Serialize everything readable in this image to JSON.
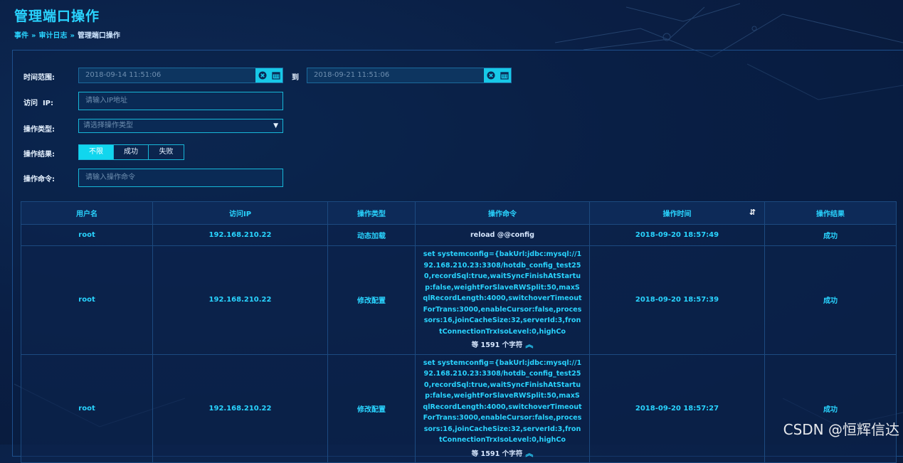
{
  "page": {
    "title": "管理端口操作",
    "breadcrumb": [
      "事件",
      "审计日志",
      "管理端口操作"
    ],
    "breadcrumb_sep": "»"
  },
  "filters": {
    "time_range_label": "时间范围:",
    "start_time": "2018-09-14 11:51:06",
    "to_label": "到",
    "end_time": "2018-09-21 11:51:06",
    "ip_label": "访问  IP:",
    "ip_placeholder": "请输入IP地址",
    "op_type_label": "操作类型:",
    "op_type_placeholder": "请选择操作类型",
    "result_label": "操作结果:",
    "result_options": [
      "不限",
      "成功",
      "失败"
    ],
    "result_selected": "不限",
    "command_label": "操作命令:",
    "command_placeholder": "请输入操作命令"
  },
  "table": {
    "headers": [
      "用户名",
      "访问IP",
      "操作类型",
      "操作命令",
      "操作时间",
      "操作结果"
    ],
    "rows": [
      {
        "user": "root",
        "ip": "192.168.210.22",
        "type": "动态加载",
        "command": "reload @@config",
        "more": "",
        "time": "2018-09-20 18:57:49",
        "result": "成功"
      },
      {
        "user": "root",
        "ip": "192.168.210.22",
        "type": "修改配置",
        "command": "set systemconfig={bakUrl:jdbc:mysql://192.168.210.23:3308/hotdb_config_test250,recordSql:true,waitSyncFinishAtStartup:false,weightForSlaveRWSplit:50,maxSqlRecordLength:4000,switchoverTimeoutForTrans:3000,enableCursor:false,processors:16,joinCacheSize:32,serverId:3,frontConnectionTrxIsoLevel:0,highCo",
        "more": "等 1591 个字符",
        "time": "2018-09-20 18:57:39",
        "result": "成功"
      },
      {
        "user": "root",
        "ip": "192.168.210.22",
        "type": "修改配置",
        "command": "set systemconfig={bakUrl:jdbc:mysql://192.168.210.23:3308/hotdb_config_test250,recordSql:true,waitSyncFinishAtStartup:false,weightForSlaveRWSplit:50,maxSqlRecordLength:4000,switchoverTimeoutForTrans:3000,enableCursor:false,processors:16,joinCacheSize:32,serverId:3,frontConnectionTrxIsoLevel:0,highCo",
        "more": "等 1591 个字符",
        "time": "2018-09-20 18:57:27",
        "result": "成功"
      }
    ]
  },
  "watermark": "CSDN @恒辉信达",
  "colors": {
    "accent": "#29d4ff",
    "success": "#3ee07a",
    "background": "#0a1f45"
  }
}
